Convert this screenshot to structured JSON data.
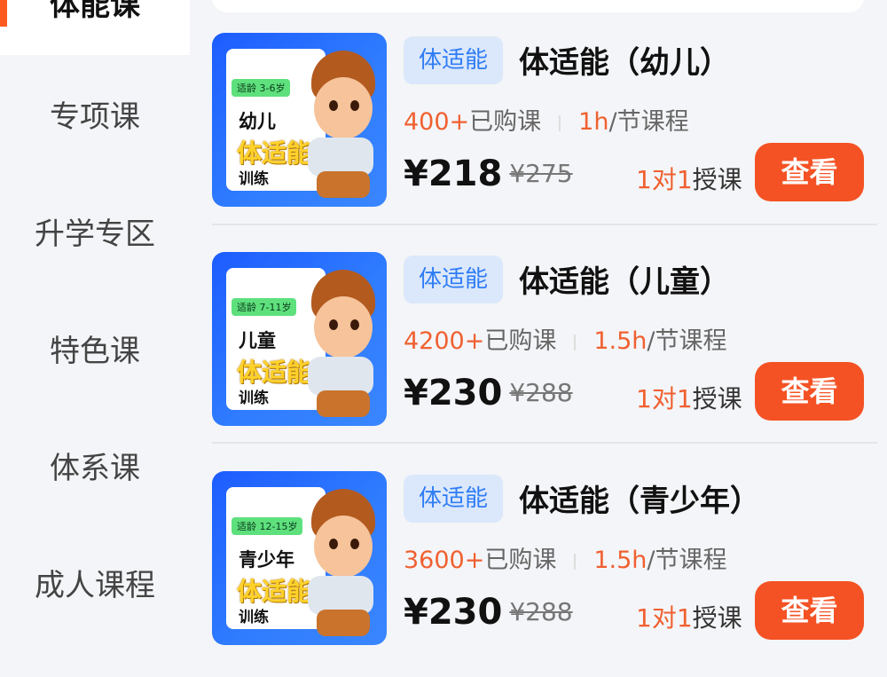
{
  "sidebar": {
    "active_label": "体能课",
    "items": [
      {
        "label": "专项课"
      },
      {
        "label": "升学专区"
      },
      {
        "label": "特色课"
      },
      {
        "label": "体系课"
      },
      {
        "label": "成人课程"
      }
    ]
  },
  "courses": [
    {
      "tag": "体适能",
      "title": "体适能（幼儿）",
      "buyers": "400+",
      "buyers_suffix": "已购课",
      "duration": "1h",
      "duration_suffix": "/节课程",
      "price": "¥218",
      "original_price": "¥275",
      "mode_highlight": "1对1",
      "mode_suffix": "授课",
      "button": "查看",
      "thumb": {
        "age": "适龄 3-6岁",
        "line1": "幼儿",
        "line2": "体适能",
        "line3": "训练"
      }
    },
    {
      "tag": "体适能",
      "title": "体适能（儿童）",
      "buyers": "4200+",
      "buyers_suffix": "已购课",
      "duration": "1.5h",
      "duration_suffix": "/节课程",
      "price": "¥230",
      "original_price": "¥288",
      "mode_highlight": "1对1",
      "mode_suffix": "授课",
      "button": "查看",
      "thumb": {
        "age": "适龄 7-11岁",
        "line1": "儿童",
        "line2": "体适能",
        "line3": "训练"
      }
    },
    {
      "tag": "体适能",
      "title": "体适能（青少年）",
      "buyers": "3600+",
      "buyers_suffix": "已购课",
      "duration": "1.5h",
      "duration_suffix": "/节课程",
      "price": "¥230",
      "original_price": "¥288",
      "mode_highlight": "1对1",
      "mode_suffix": "授课",
      "button": "查看",
      "thumb": {
        "age": "适龄 12-15岁",
        "line1": "青少年",
        "line2": "体适能",
        "line3": "训练"
      }
    }
  ],
  "colors": {
    "accent": "#f45224",
    "tag_bg": "#dbe8fb",
    "tag_text": "#2f7cf6"
  }
}
